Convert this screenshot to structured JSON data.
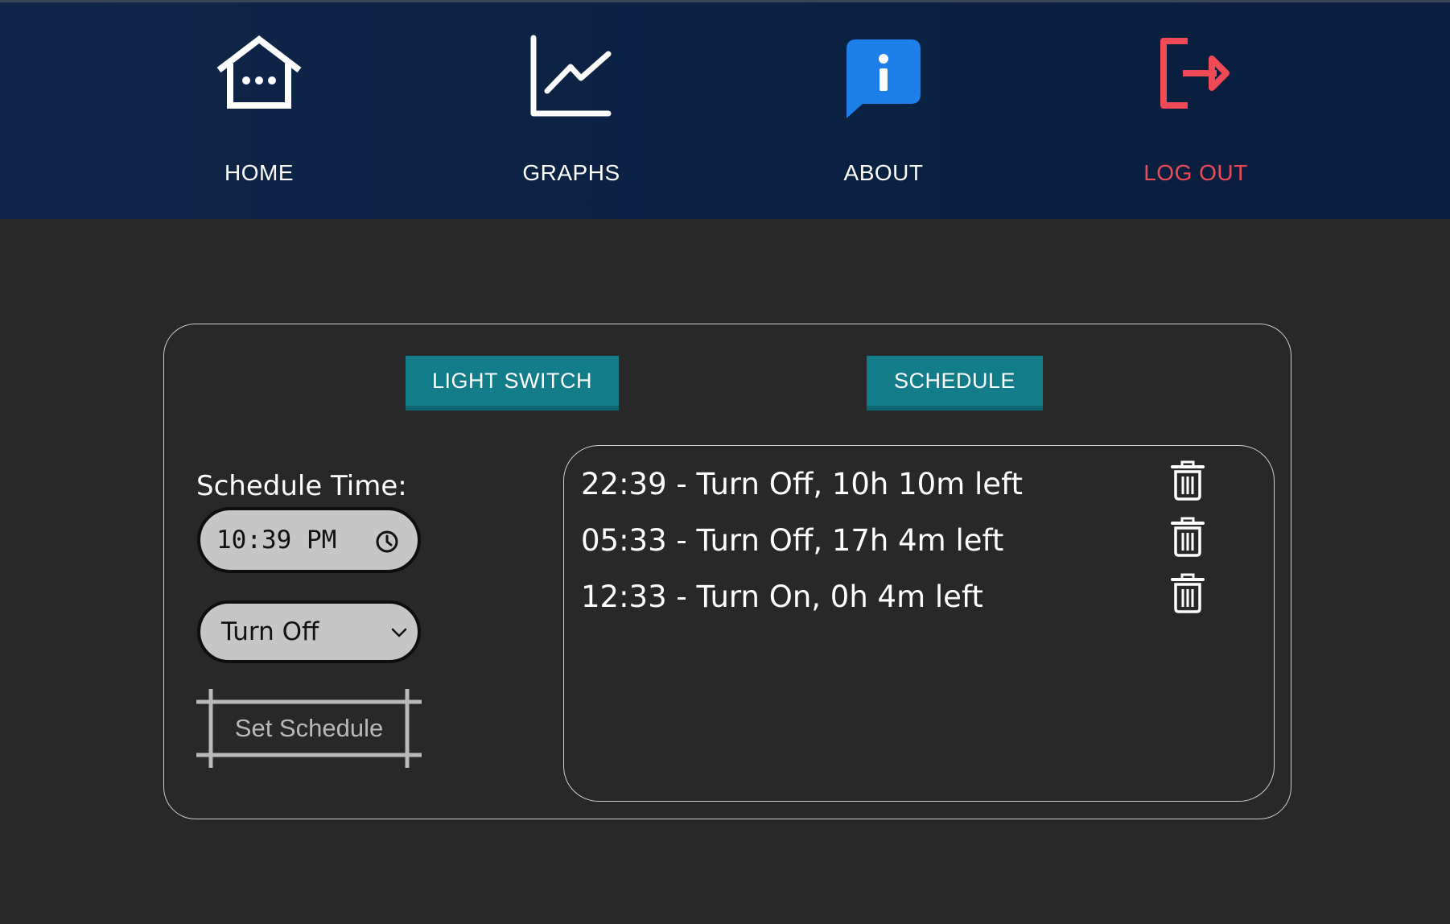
{
  "nav": {
    "items": [
      {
        "label": "HOME",
        "icon": "home-icon"
      },
      {
        "label": "GRAPHS",
        "icon": "graph-icon"
      },
      {
        "label": "ABOUT",
        "icon": "info-icon"
      },
      {
        "label": "LOG OUT",
        "icon": "logout-icon"
      }
    ],
    "logout_color": "#ef4a55",
    "about_icon_color": "#1f7fea"
  },
  "tabs": {
    "light_switch": "LIGHT SWITCH",
    "schedule": "SCHEDULE",
    "color": "#127c88"
  },
  "form": {
    "label": "Schedule Time:",
    "time_value": "10:39 PM",
    "action_value": "Turn Off",
    "submit_label": "Set Schedule"
  },
  "schedules": [
    {
      "text": "22:39 - Turn Off, 10h 10m left"
    },
    {
      "text": "05:33 - Turn Off, 17h 4m left"
    },
    {
      "text": "12:33 - Turn On, 0h 4m left"
    }
  ]
}
